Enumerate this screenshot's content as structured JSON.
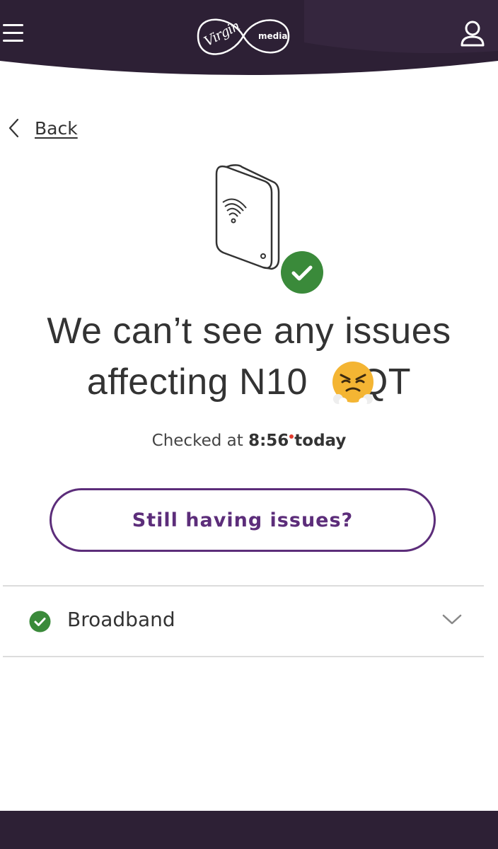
{
  "header": {
    "logo_text_primary": "Virgin",
    "logo_text_secondary": "media",
    "bg_color": "#2d2035",
    "icons": [
      "menu-icon",
      "account-icon"
    ]
  },
  "nav": {
    "back_label": "Back"
  },
  "status": {
    "headline_line1": "We can’t see any issues",
    "headline_line2_prefix": "affecting N10 ",
    "headline_line2_suffix": "QT",
    "emoji": "😤",
    "checked_prefix": "Checked at ",
    "checked_time": "8:56",
    "checked_suffix": " today",
    "status_color": "#3a8a3a"
  },
  "cta": {
    "label": "Still having issues?",
    "color": "#5c2d7a"
  },
  "services": [
    {
      "name": "Broadband",
      "status": "ok"
    }
  ]
}
